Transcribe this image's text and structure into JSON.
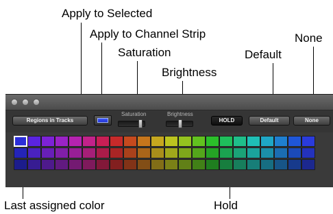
{
  "callouts": {
    "apply_to_selected": "Apply to Selected",
    "apply_to_channel_strip": "Apply to Channel Strip",
    "saturation": "Saturation",
    "brightness": "Brightness",
    "default": "Default",
    "none": "None",
    "last_assigned_color": "Last assigned color",
    "hold": "Hold"
  },
  "toolbar": {
    "target_selector_label": "Regions in Tracks",
    "saturation_label": "Saturation",
    "brightness_label": "Brightness",
    "hold_label": "HOLD",
    "default_label": "Default",
    "none_label": "None"
  },
  "colors": {
    "window_bg": "#3a3a3a",
    "button_text": "#f2f2f2",
    "selected_outline": "#ffffff"
  },
  "palette": {
    "rows": [
      [
        "#2b2ed8",
        "#5a24e0",
        "#7d22d8",
        "#9a23c6",
        "#b523b0",
        "#c3228a",
        "#c81f55",
        "#c72a2a",
        "#c64a1e",
        "#c6761c",
        "#c6a71f",
        "#bcc41f",
        "#95c31f",
        "#62c21f",
        "#2bbf2a",
        "#1fbf5c",
        "#1fbf8a",
        "#1fbfb6",
        "#1fa7c6",
        "#1f7fd0",
        "#1f56d8",
        "#2a3bdc"
      ],
      [
        "#2424b8",
        "#4a22c0",
        "#681fb8",
        "#801fa8",
        "#981f96",
        "#a61f78",
        "#aa1c49",
        "#a92525",
        "#a9411b",
        "#a96519",
        "#a98f1b",
        "#a0a81b",
        "#7fa71b",
        "#54a61b",
        "#25a325",
        "#1ba350",
        "#1ba377",
        "#1ba39c",
        "#1b8fa9",
        "#1b6db2",
        "#1b4ab8",
        "#2432bc"
      ],
      [
        "#1c1c8c",
        "#371c92",
        "#4e1a8c",
        "#611a80",
        "#741a72",
        "#7f1a5c",
        "#821839",
        "#821f1f",
        "#823317",
        "#824e16",
        "#826e17",
        "#7b8117",
        "#618017",
        "#418017",
        "#1f7e1f",
        "#177e3e",
        "#177e5c",
        "#177e78",
        "#176e82",
        "#175588",
        "#173a8c",
        "#1c288f"
      ]
    ],
    "selected_index": 0
  }
}
